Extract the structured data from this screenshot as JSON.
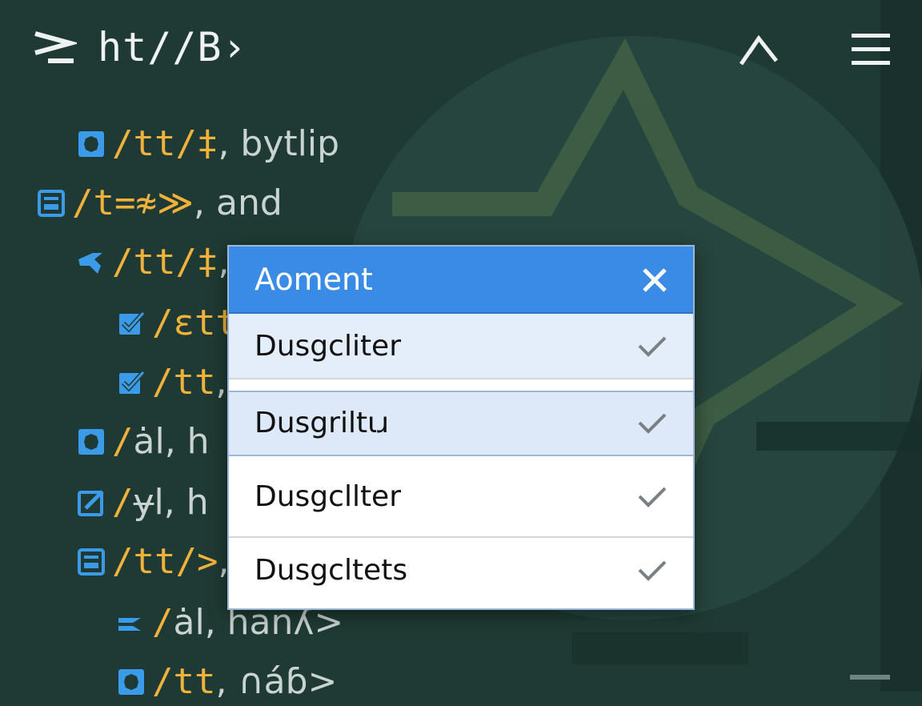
{
  "header": {
    "title": "ht//B›",
    "prompt_icon": "terminal-prompt-icon",
    "collapse_icon": "chevron-up-icon",
    "menu_icon": "hamburger-menu-icon"
  },
  "tree": [
    {
      "icon": "puzzle-icon",
      "path": "/tt/‡",
      "desc": ", bytlip"
    },
    {
      "icon": "window-icon",
      "path": "/t=≉≫",
      "desc": ", and"
    },
    {
      "icon": "tag-icon",
      "path": "/tt/‡",
      "desc": ","
    },
    {
      "icon": "edit-check-icon",
      "path": "/ɛtt",
      "desc": ""
    },
    {
      "icon": "edit-check-icon",
      "path": "/tt",
      "desc": ","
    },
    {
      "icon": "puzzle-icon",
      "path": "/",
      "desc": "ȧl, h"
    },
    {
      "icon": "edit-box-icon",
      "path": "/",
      "desc": "ɏl, h"
    },
    {
      "icon": "window-icon",
      "path": "/tt/>",
      "desc": ","
    },
    {
      "icon": "link-icon",
      "path": "/",
      "desc": "ȧl, hanʎ>"
    },
    {
      "icon": "puzzle-icon",
      "path": "/tt",
      "desc": ", ∩áɓ>"
    }
  ],
  "dialog": {
    "title": "Aoment",
    "close_icon": "close-icon",
    "options": [
      {
        "label": "Dusgcliter",
        "check_icon": "check-icon",
        "state": "highlighted"
      },
      {
        "label": "Dusgriltɩɹ",
        "check_icon": "check-icon",
        "state": "selected"
      },
      {
        "label": "Dusgcllter",
        "check_icon": "check-icon",
        "state": "normal"
      },
      {
        "label": "Dusgcltets",
        "check_icon": "check-icon",
        "state": "normal"
      }
    ]
  },
  "colors": {
    "background": "#1f3a34",
    "accent": "#3a8be6",
    "path_text": "#f0b23a",
    "icon_blue": "#3b9be8"
  }
}
